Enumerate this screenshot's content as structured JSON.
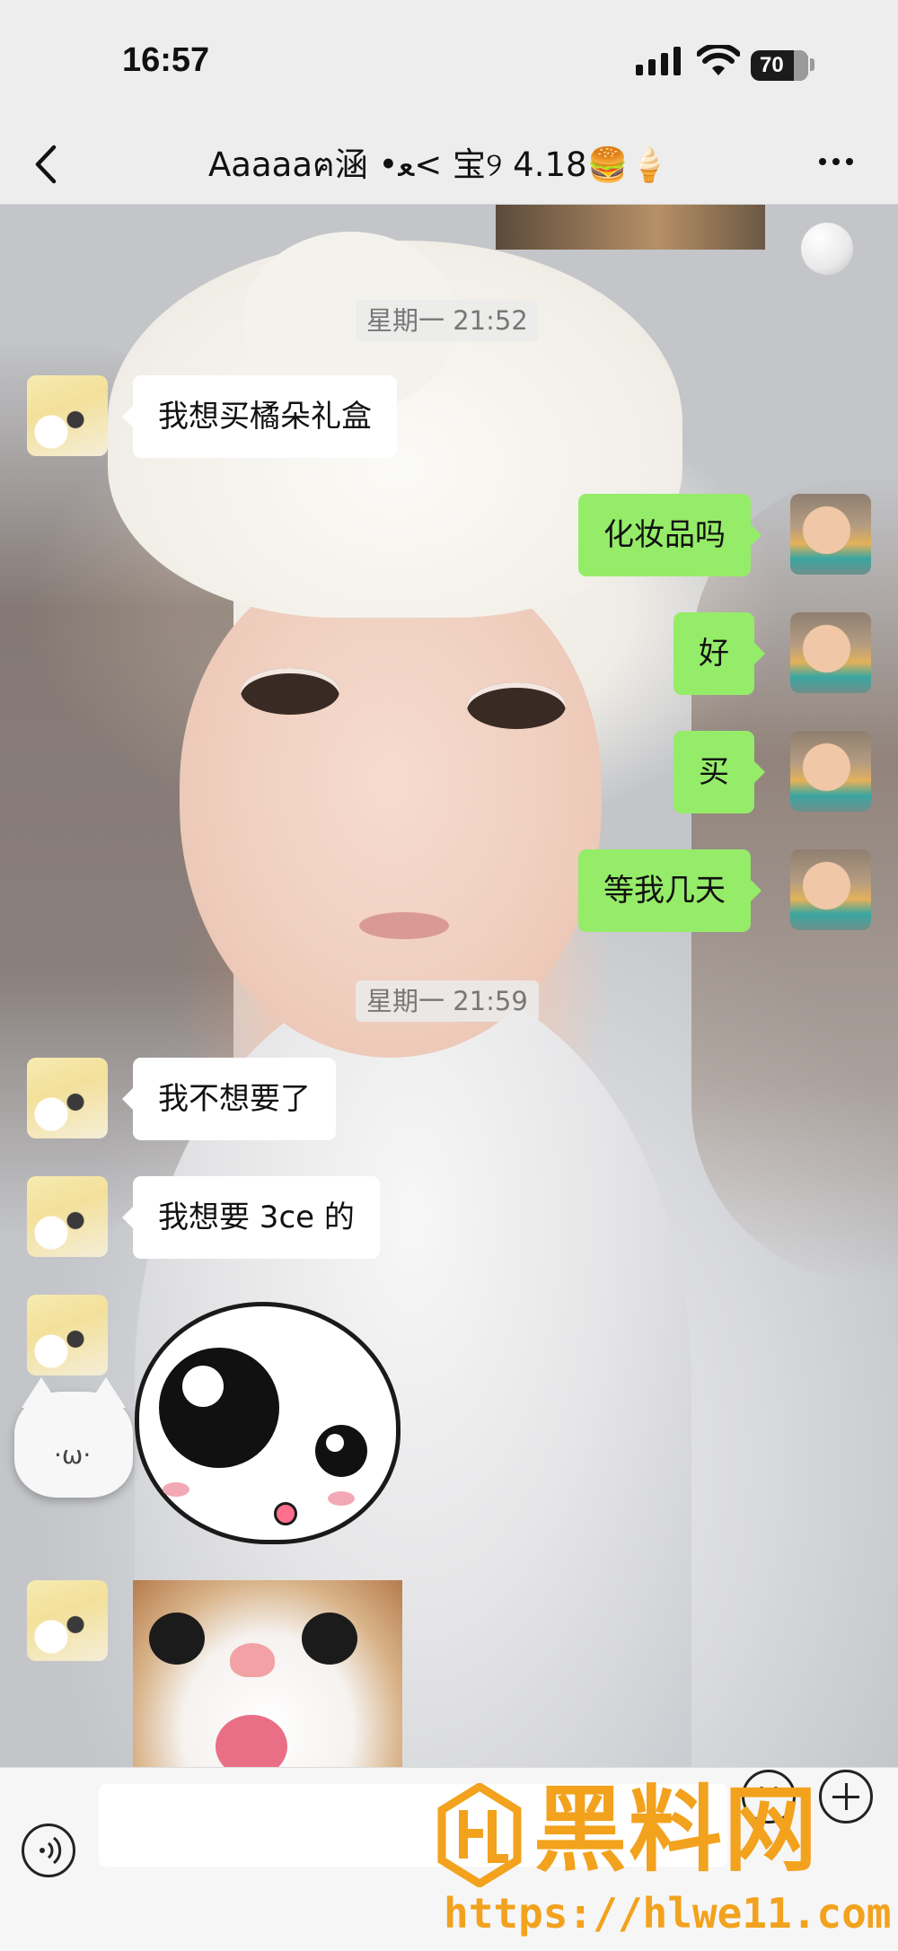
{
  "status_bar": {
    "time": "16:57",
    "battery": "70",
    "icons": [
      "signal-icon",
      "wifi-icon",
      "battery-icon"
    ]
  },
  "nav": {
    "title": "Aaaaaฅ涵 •ﻌ< 宝୨ 4.18🍔🍦",
    "back_icon": "chevron-left-icon",
    "more_icon": "more-dots-icon"
  },
  "messages": {
    "ts1": "星期一 21:52",
    "m1": "我想买橘朵礼盒",
    "m2": "化妆品吗",
    "m3": "好",
    "m4": "买",
    "m5": "等我几天",
    "ts2": "星期一 21:59",
    "m6": "我不想要了",
    "m7": "我想要 3ce 的",
    "sticker_face": "·ω·"
  },
  "input_bar": {
    "placeholder": "",
    "icons": [
      "voice-icon",
      "emoji-icon",
      "plus-icon"
    ]
  },
  "watermark": {
    "brand": "黑料网",
    "url": "https://hlwe11.com"
  },
  "colors": {
    "outgoing_bubble": "#95ec69",
    "incoming_bubble": "#ffffff",
    "watermark": "#f2a21d",
    "bar_background": "#ededed"
  }
}
